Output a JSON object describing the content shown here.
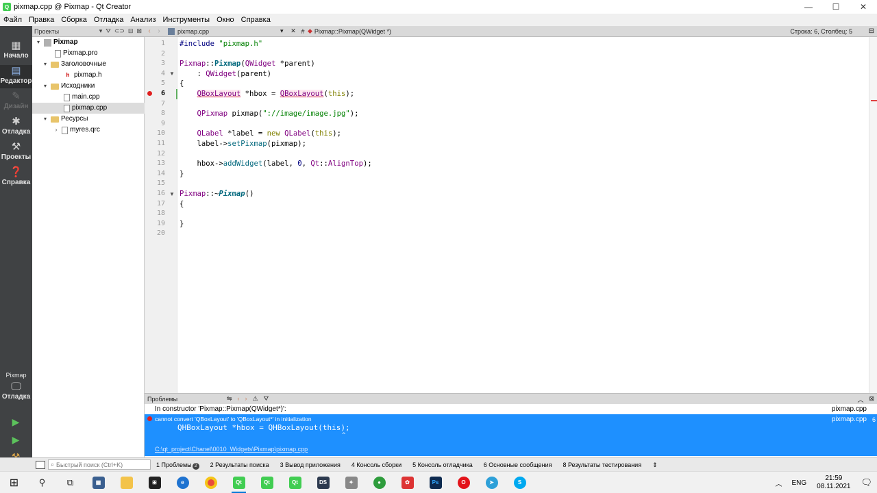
{
  "window": {
    "title": "pixmap.cpp @ Pixmap - Qt Creator",
    "minimize": "—",
    "maximize": "☐",
    "close": "✕"
  },
  "menu": [
    "Файл",
    "Правка",
    "Сборка",
    "Отладка",
    "Анализ",
    "Инструменты",
    "Окно",
    "Справка"
  ],
  "modes": {
    "welcome": "Начало",
    "edit": "Редактор",
    "design": "Дизайн",
    "debug": "Отладка",
    "projects": "Проекты",
    "help": "Справка"
  },
  "kit": {
    "project": "Pixmap",
    "config": "Отладка"
  },
  "projects_pane": {
    "title": "Проекты"
  },
  "tree": [
    {
      "label": "Pixmap",
      "bold": true
    },
    {
      "label": "Pixmap.pro"
    },
    {
      "label": "Заголовочные"
    },
    {
      "label": "pixmap.h"
    },
    {
      "label": "Исходники"
    },
    {
      "label": "main.cpp"
    },
    {
      "label": "pixmap.cpp"
    },
    {
      "label": "Ресурсы"
    },
    {
      "label": "myres.qrc"
    }
  ],
  "editor_toolbar": {
    "file": "pixmap.cpp",
    "hash": "#",
    "symbol": "Pixmap::Pixmap(QWidget *)",
    "position": "Строка: 6, Столбец: 5"
  },
  "code": {
    "line_numbers": [
      "1",
      "2",
      "3",
      "4",
      "5",
      "6",
      "7",
      "8",
      "9",
      "10",
      "11",
      "12",
      "13",
      "14",
      "15",
      "16",
      "17",
      "18",
      "19",
      "20"
    ],
    "current_line": "6",
    "l1_pp": "#include ",
    "l1_str": "\"pixmap.h\"",
    "l3_class": "Pixmap",
    "l3_sep": "::",
    "l3_fn": "Pixmap",
    "l3_open": "(",
    "l3_type": "QWidget",
    "l3_rest": " *parent)",
    "l4_indent": "    : ",
    "l4_type": "QWidget",
    "l4_rest": "(parent)",
    "l5": "{",
    "l6_type1": "QBoxLayout",
    "l6_mid": " *hbox = ",
    "l6_type2": "QBoxLayout",
    "l6_open": "(",
    "l6_kw": "this",
    "l6_close": ");",
    "l8_type": "QPixmap",
    "l8_mid": " pixmap(",
    "l8_str": "\"://image/image.jpg\"",
    "l8_close": ");",
    "l10_type": "QLabel",
    "l10_mid": " *label = ",
    "l10_kw": "new",
    "l10_sp": " ",
    "l10_type2": "QLabel",
    "l10_open": "(",
    "l10_kw2": "this",
    "l10_close": ");",
    "l11_pre": "label->",
    "l11_fn": "setPixmap",
    "l11_rest": "(pixmap);",
    "l13_pre": "hbox->",
    "l13_fn": "addWidget",
    "l13_mid": "(label, ",
    "l13_num": "0",
    "l13_comma": ", ",
    "l13_ns": "Qt",
    "l13_sep": "::",
    "l13_enum": "AlignTop",
    "l13_close": ");",
    "l14": "}",
    "l16_class": "Pixmap",
    "l16_sep": "::~",
    "l16_fn": "Pixmap",
    "l16_rest": "()",
    "l17": "{",
    "l19": "}"
  },
  "issues_pane": {
    "title": "Проблемы",
    "context": "In constructor 'Pixmap::Pixmap(QWidget*)':",
    "context_file": "pixmap.cpp",
    "error": "cannot convert 'QBoxLayout' to 'QBoxLayout*' in initialization",
    "error_file": "pixmap.cpp",
    "error_line": "6",
    "snippet": "QHBoxLayout *hbox = QHBoxLayout(this);",
    "caret": "^",
    "path": "C:\\qt_project\\Chanel\\0010_Widgets\\Pixmap\\pixmap.cpp"
  },
  "statusbar": {
    "search_placeholder": "Быстрый поиск (Ctrl+K)",
    "tabs": [
      {
        "label": "1  Проблемы",
        "badge": "2"
      },
      {
        "label": "2  Результаты поиска"
      },
      {
        "label": "3  Вывод приложения"
      },
      {
        "label": "4  Консоль сборки"
      },
      {
        "label": "5  Консоль отладчика"
      },
      {
        "label": "6  Основные сообщения"
      },
      {
        "label": "8  Результаты тестирования"
      }
    ],
    "more": "⇕"
  },
  "taskbar": {
    "lang": "ENG",
    "time": "21:59",
    "date": "08.11.2021"
  },
  "colors": {
    "modebar": "#404244",
    "selection": "#1e90ff",
    "error": "#e02020"
  }
}
